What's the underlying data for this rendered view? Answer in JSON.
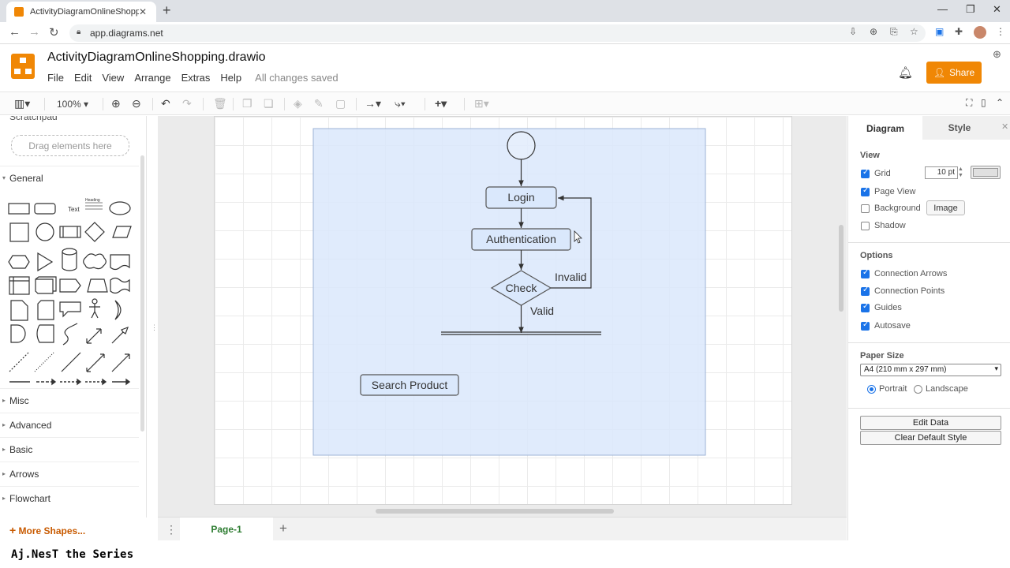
{
  "browser": {
    "tab_title": "ActivityDiagramOnlineShopping",
    "tab_close": "✕",
    "new_tab": "+",
    "url": "app.diagrams.net",
    "window_controls": [
      "—",
      "❐",
      "✕"
    ]
  },
  "app": {
    "document_title": "ActivityDiagramOnlineShopping.drawio",
    "menu": [
      "File",
      "Edit",
      "View",
      "Arrange",
      "Extras",
      "Help"
    ],
    "save_status": "All changes saved",
    "share_label": "Share",
    "brand_color": "#f08705"
  },
  "toolbar": {
    "zoom": "100%"
  },
  "left_panel": {
    "scratchpad_label": "Scratchpad",
    "drop_hint": "Drag elements here",
    "sections": [
      {
        "label": "General",
        "open": true
      },
      {
        "label": "Misc"
      },
      {
        "label": "Advanced"
      },
      {
        "label": "Basic"
      },
      {
        "label": "Arrows"
      },
      {
        "label": "Flowchart"
      }
    ],
    "text_shape_label": "Text",
    "heading_shape_label": "Heading",
    "more_shapes": "More Shapes..."
  },
  "diagram": {
    "nodes": {
      "login": "Login",
      "authentication": "Authentication",
      "check": "Check",
      "search_product": "Search Product"
    },
    "edge_labels": {
      "invalid": "Invalid",
      "valid": "Valid"
    },
    "container_fill": "#dae8fc"
  },
  "page_tabs": {
    "active": "Page-1"
  },
  "right_panel": {
    "tabs": [
      "Diagram",
      "Style"
    ],
    "view_heading": "View",
    "view_options": [
      {
        "label": "Grid",
        "checked": true
      },
      {
        "label": "Page View",
        "checked": true
      },
      {
        "label": "Background",
        "checked": false
      },
      {
        "label": "Shadow",
        "checked": false
      }
    ],
    "grid_size": "10 pt",
    "image_button": "Image",
    "options_heading": "Options",
    "options": [
      {
        "label": "Connection Arrows",
        "checked": true
      },
      {
        "label": "Connection Points",
        "checked": true
      },
      {
        "label": "Guides",
        "checked": true
      },
      {
        "label": "Autosave",
        "checked": true
      }
    ],
    "paper_size_heading": "Paper Size",
    "paper_size": "A4 (210 mm x 297 mm)",
    "orientation": [
      {
        "label": "Portrait",
        "selected": true
      },
      {
        "label": "Landscape",
        "selected": false
      }
    ],
    "edit_data": "Edit Data",
    "clear_default_style": "Clear Default Style"
  },
  "watermark": "Aj.NesT the Series"
}
